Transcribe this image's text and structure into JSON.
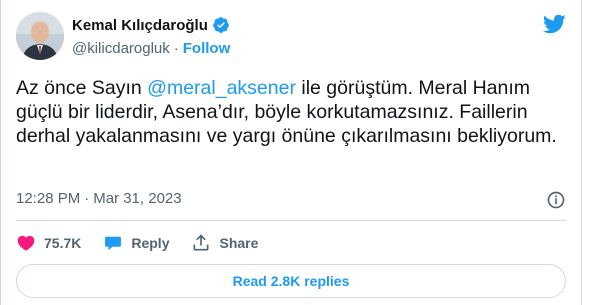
{
  "author": {
    "name": "Kemal Kılıçdaroğlu",
    "handle": "@kilicdarogluk",
    "separator": "·",
    "follow_label": "Follow",
    "avatar_icon": "person-avatar"
  },
  "tweet": {
    "text_before": "Az önce Sayın ",
    "mention": "@meral_aksener",
    "text_after": " ile görüştüm. Meral Hanım güçlü bir liderdir, Asena’dır, böyle korkutamazsınız. Faillerin derhal yakalanmasını ve yargı önüne çıkarılmasını bekliyorum.",
    "time": "12:28 PM",
    "separator": "·",
    "date": "Mar 31, 2023"
  },
  "actions": {
    "likes": "75.7K",
    "reply_label": "Reply",
    "share_label": "Share"
  },
  "replies_button": "Read 2.8K replies",
  "colors": {
    "accent": "#1d9bf0",
    "like": "#f91880",
    "text": "#0f1419",
    "muted": "#536471"
  }
}
